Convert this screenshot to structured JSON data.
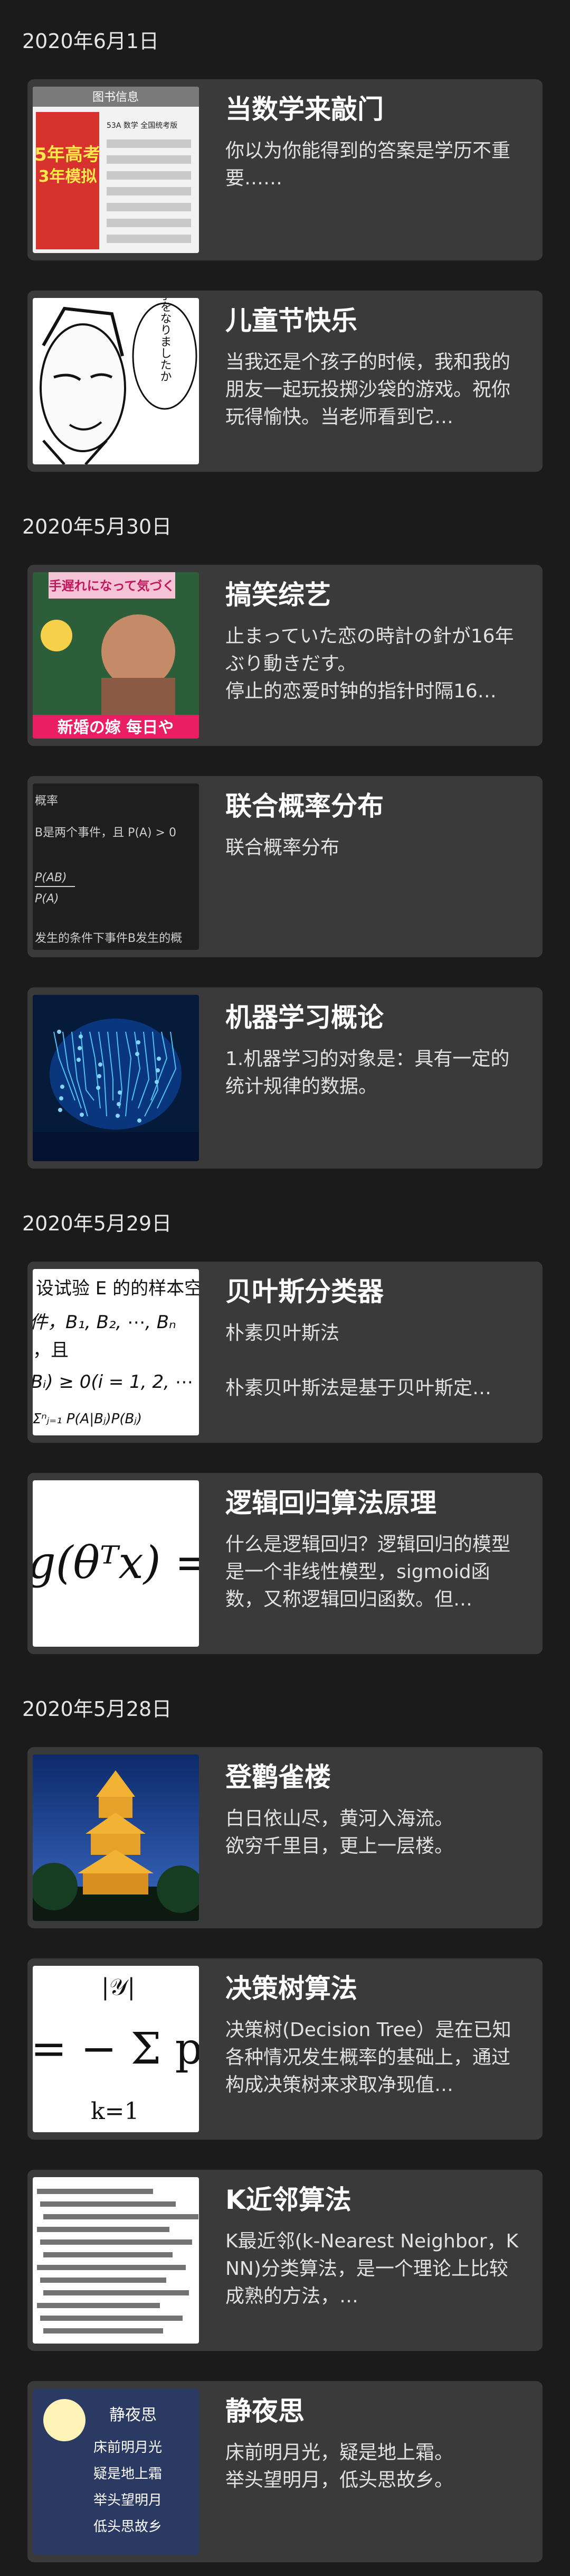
{
  "sections": [
    {
      "date": "2020年6月1日",
      "articles": [
        {
          "title": "当数学来敲门",
          "summary": "你以为你能得到的答案是学历不重要……",
          "thumb": "book-cover-image"
        },
        {
          "title": "儿童节快乐",
          "summary": "当我还是个孩子的时候，我和我的朋友一起玩投掷沙袋的游戏。祝你玩得愉快。当老师看到它…",
          "thumb": "manga-panel-image"
        }
      ]
    },
    {
      "date": "2020年5月30日",
      "articles": [
        {
          "title": "搞笑综艺",
          "summary": "止まっていた恋の時計の針が16年ぶり動きだす。\n停止的恋爱时钟的指针时隔16…",
          "thumb": "variety-show-image"
        },
        {
          "title": "联合概率分布",
          "summary": "联合概率分布",
          "thumb": "probability-formula-image"
        },
        {
          "title": "机器学习概论",
          "summary": "1.机器学习的对象是：具有一定的统计规律的数据。",
          "thumb": "circuit-brain-image"
        }
      ]
    },
    {
      "date": "2020年5月29日",
      "articles": [
        {
          "title": "贝叶斯分类器",
          "summary": "朴素贝叶斯法\n\n朴素贝叶斯法是基于贝叶斯定…",
          "thumb": "bayes-formula-image"
        },
        {
          "title": "逻辑回归算法原理",
          "summary": "什么是逻辑回归？逻辑回归的模型是一个非线性模型，sigmoid函数，又称逻辑回归函数。但…",
          "thumb": "sigmoid-formula-image"
        }
      ]
    },
    {
      "date": "2020年5月28日",
      "articles": [
        {
          "title": "登鹳雀楼",
          "summary": "白日依山尽，黄河入海流。\n欲穷千里目，更上一层楼。",
          "thumb": "tower-night-image"
        },
        {
          "title": "决策树算法",
          "summary": "决策树(Decision Tree）是在已知各种情况发生概率的基础上，通过构成决策树来求取净现值…",
          "thumb": "entropy-formula-image"
        },
        {
          "title": "K近邻算法",
          "summary": "K最近邻(k-Nearest Neighbor，KNN)分类算法，是一个理论上比较成熟的方法，…",
          "thumb": "distance-formula-image"
        },
        {
          "title": "静夜思",
          "summary": "床前明月光，疑是地上霜。\n举头望明月，低头思故乡。",
          "thumb": "moon-poem-image"
        }
      ]
    }
  ],
  "thumb_text": {
    "book_header": "图书信息",
    "book_title": "5年高考 3年模拟",
    "book_label": "53A 数学 全国统考版",
    "manga_text": "お手をなりましたか",
    "tv_caption": "新婚の嫁 每日や",
    "tv_banner": "手遅れになって気づく",
    "prob_lines": [
      "概率",
      "B是两个事件，且 P(A) > 0",
      "P(AB)",
      "P(A)",
      "发生的条件下事件B发生的概"
    ],
    "bayes_lines": [
      "设试验 E 的的样本空",
      "件，B₁, B₂, ⋯, Bₙ",
      "，且",
      "Bᵢ) ≥ 0(i = 1, 2, ⋯",
      "Σⁿⱼ₌₁ P(A|Bⱼ)P(Bⱼ)"
    ],
    "sigmoid_text": "g(θᵀx) =",
    "entropy_text_top": "|𝒴|",
    "entropy_text_main": "= − Σ p",
    "entropy_text_bottom": "k=1",
    "poem_title": "静夜思",
    "poem_lines": [
      "床前明月光",
      "疑是地上霜",
      "举头望明月",
      "低头思故乡"
    ]
  }
}
